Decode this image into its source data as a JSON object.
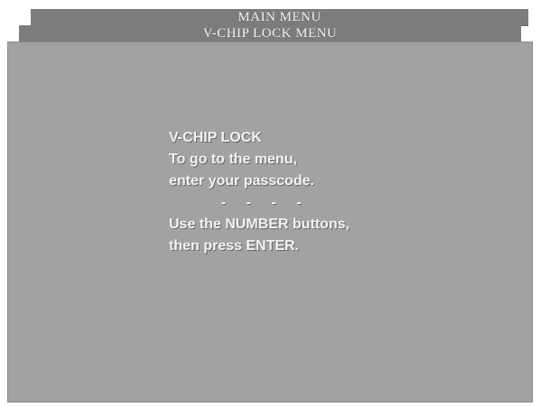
{
  "header": {
    "main_menu_title": "MAIN MENU",
    "submenu_title": "V-CHIP LOCK MENU"
  },
  "dialog": {
    "title": "V-CHIP LOCK",
    "line1": "To go to the menu,",
    "line2": "enter your passcode.",
    "passcode_placeholder": "- - - -",
    "line3": "Use the NUMBER buttons,",
    "line4": "then press ENTER."
  },
  "colors": {
    "panel_gray": "#b5b5b5",
    "bar_gray": "#8f8f8f",
    "text": "#f2f2f2"
  }
}
